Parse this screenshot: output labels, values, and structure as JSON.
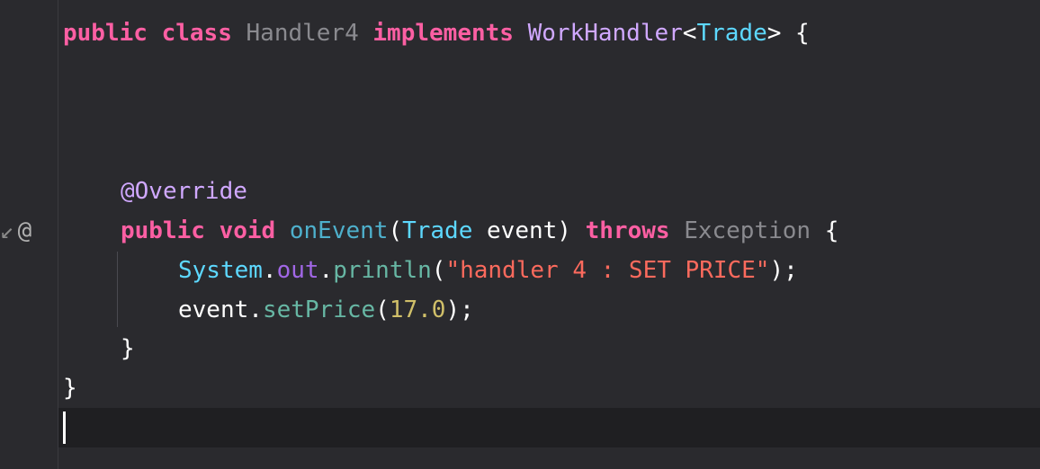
{
  "editor": {
    "gutter_marker": "@",
    "gutter_arrow": "↙",
    "lines": {
      "l1": {
        "kw_public": "public",
        "kw_class": "class",
        "class_name": "Handler4",
        "kw_implements": "implements",
        "iface": "WorkHandler",
        "lt": "<",
        "generic": "Trade",
        "gt_brace": "> {"
      },
      "l2": {
        "annotation": "@Override"
      },
      "l3": {
        "kw_public": "public",
        "kw_void": "void",
        "method": "onEvent",
        "open_paren": "(",
        "param_type": "Trade",
        "param_name": " event)",
        "kw_throws": "throws",
        "exception": "Exception",
        "brace": " {"
      },
      "l4": {
        "system": "System",
        "dot1": ".",
        "out": "out",
        "dot2": ".",
        "println": "println",
        "open_paren": "(",
        "string": "\"handler 4 : SET PRICE\"",
        "close": ");"
      },
      "l5": {
        "obj": "event",
        "dot": ".",
        "method": "setPrice",
        "open_paren": "(",
        "number": "17.0",
        "close": ");"
      },
      "l6": {
        "brace": "}"
      },
      "l7": {
        "brace": "}"
      }
    }
  }
}
